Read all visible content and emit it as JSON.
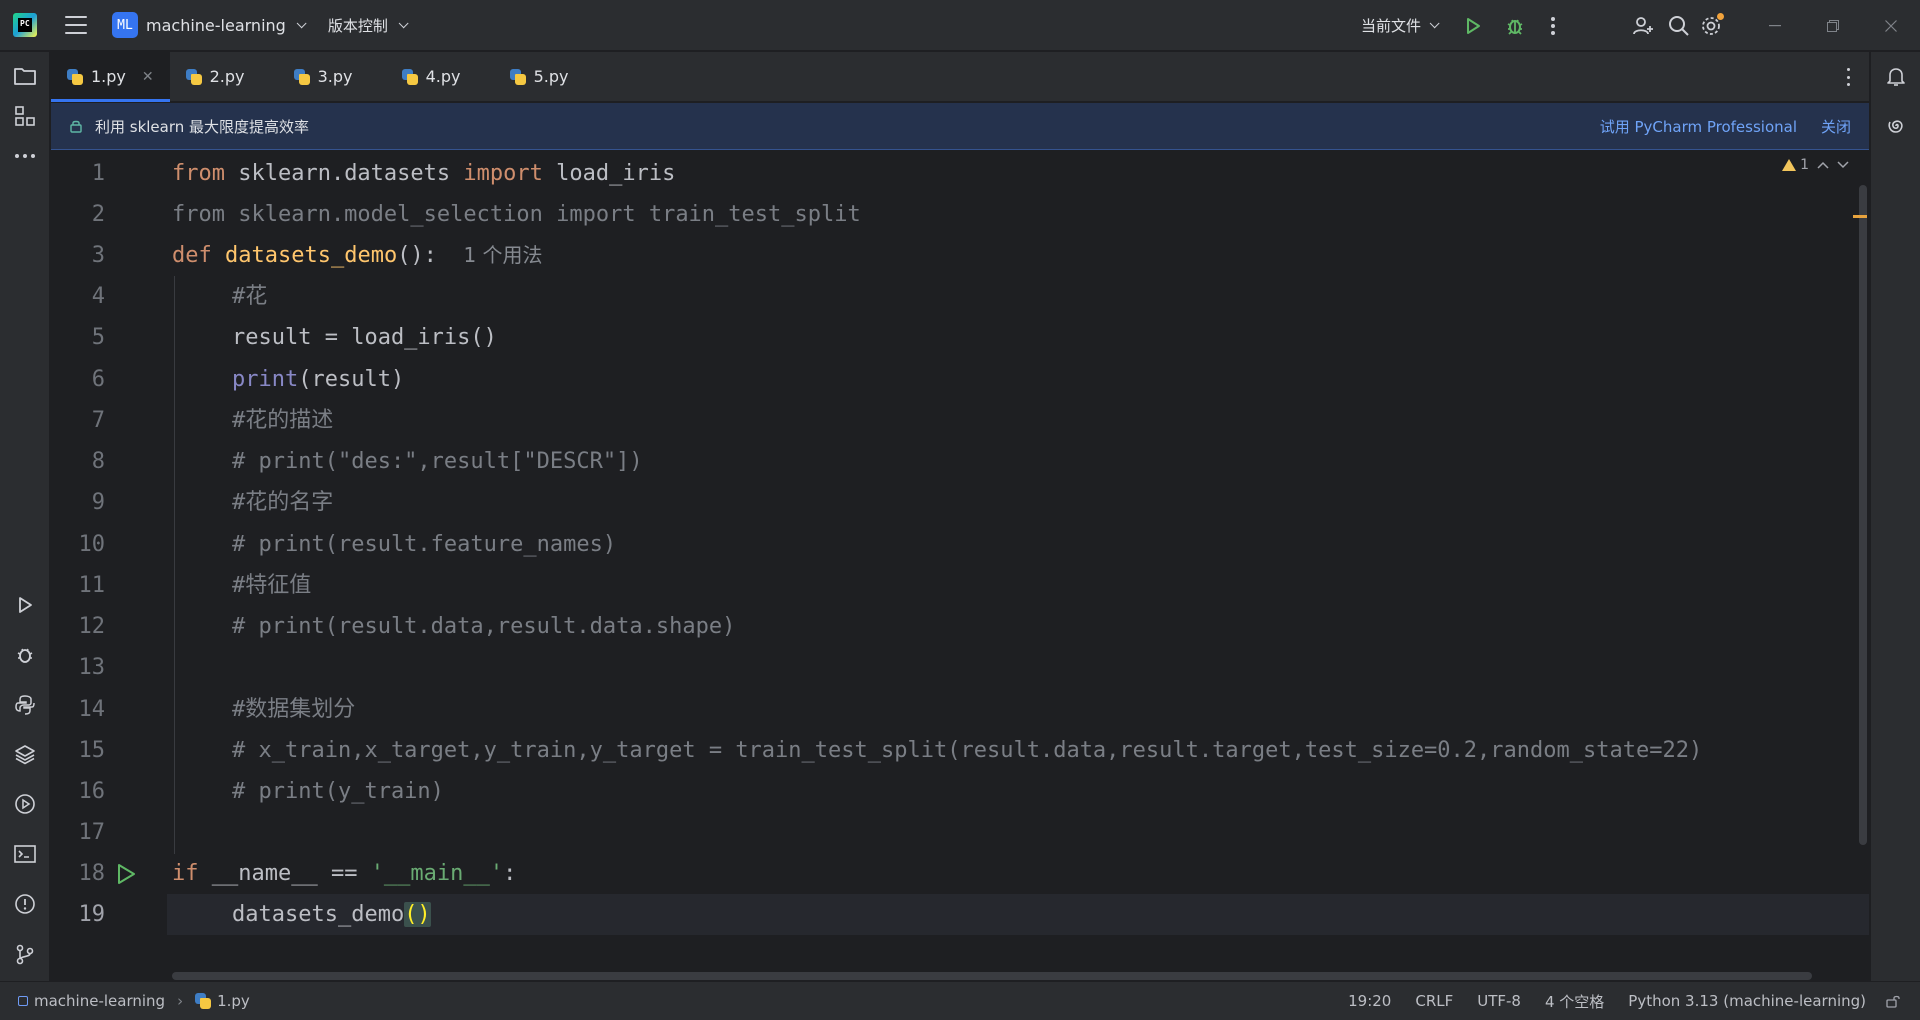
{
  "titlebar": {
    "project_badge": "ML",
    "project_name": "machine-learning",
    "vcs_label": "版本控制",
    "run_config": "当前文件"
  },
  "tabs": [
    {
      "label": "1.py",
      "active": true
    },
    {
      "label": "2.py",
      "active": false
    },
    {
      "label": "3.py",
      "active": false
    },
    {
      "label": "4.py",
      "active": false
    },
    {
      "label": "5.py",
      "active": false
    }
  ],
  "banner": {
    "text": "利用 sklearn 最大限度提高效率",
    "link": "试用 PyCharm Professional",
    "close": "关闭"
  },
  "editor": {
    "warning_count": "1",
    "current_line": 19,
    "line_numbers": [
      "1",
      "2",
      "3",
      "4",
      "5",
      "6",
      "7",
      "8",
      "9",
      "10",
      "11",
      "12",
      "13",
      "14",
      "15",
      "16",
      "17",
      "18",
      "19"
    ],
    "lines": {
      "l1": {
        "kw1": "from",
        "mod": " sklearn.datasets ",
        "kw2": "import",
        "name": " load_iris"
      },
      "l2": {
        "text": "from sklearn.model_selection import train_test_split"
      },
      "l3": {
        "kw": "def",
        "name": "datasets_demo",
        "rest": "():",
        "hint": "1 个用法"
      },
      "l4": {
        "comment": "#花"
      },
      "l5": {
        "text": "result = load_iris()"
      },
      "l6": {
        "builtin": "print",
        "rest": "(result)"
      },
      "l7": {
        "comment": "#花的描述"
      },
      "l8": {
        "comment": "# print(\"des:\",result[\"DESCR\"])"
      },
      "l9": {
        "comment": "#花的名字"
      },
      "l10": {
        "comment": "# print(result.feature_names)"
      },
      "l11": {
        "comment": "#特征值"
      },
      "l12": {
        "comment": "# print(result.data,result.data.shape)"
      },
      "l14": {
        "comment": "#数据集划分"
      },
      "l15": {
        "comment": "# x_train,x_target,y_train,y_target = train_test_split(result.data,result.target,test_size=0.2,random_state=22)"
      },
      "l16": {
        "comment": "# print(y_train)"
      },
      "l18": {
        "kw": "if",
        "mid": " __name__ == ",
        "str": "'__main__'",
        "end": ":"
      },
      "l19": {
        "call": "datasets_demo",
        "parens": "()"
      }
    }
  },
  "statusbar": {
    "project": "machine-learning",
    "file": "1.py",
    "position": "19:20",
    "line_sep": "CRLF",
    "encoding": "UTF-8",
    "indent": "4 个空格",
    "interpreter": "Python 3.13 (machine-learning)"
  },
  "colors": {
    "accent": "#3574f0",
    "keyword": "#cf8e6d",
    "function_def": "#ffc66d",
    "string": "#6aab73",
    "comment": "#7a7e85",
    "run_green": "#5fb865",
    "warning": "#f2c55c"
  }
}
